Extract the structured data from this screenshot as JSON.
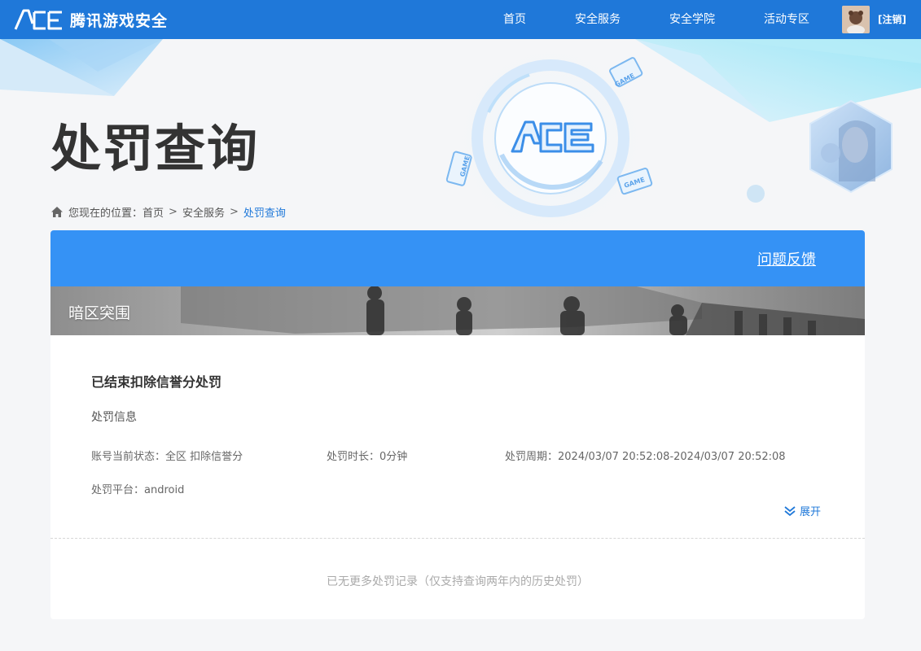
{
  "header": {
    "brand": "腾讯游戏安全",
    "nav": [
      {
        "label": "首页"
      },
      {
        "label": "安全服务"
      },
      {
        "label": "安全学院"
      },
      {
        "label": "活动专区"
      }
    ],
    "logout_label": "[注销]"
  },
  "hero": {
    "title": "处罚查询",
    "badge_text": "GAME"
  },
  "breadcrumb": {
    "prefix": "您现在的位置：",
    "items": [
      "首页",
      "安全服务",
      "处罚查询"
    ],
    "separator": ">"
  },
  "card": {
    "feedback_label": "问题反馈",
    "game_name": "暗区突围",
    "record_title": "已结束扣除信誉分处罚",
    "info_title": "处罚信息",
    "fields": {
      "status": "账号当前状态：全区 扣除信誉分",
      "duration": "处罚时长：0分钟",
      "period": "处罚周期：2024/03/07 20:52:08-2024/03/07 20:52:08",
      "platform": "处罚平台：android"
    },
    "expand_label": "展开",
    "no_more_text": "已无更多处罚记录（仅支持查询两年内的历史处罚）"
  },
  "colors": {
    "header_blue": "#1f78d9",
    "card_header_blue": "#3592f5",
    "link_blue": "#1f78d9"
  }
}
